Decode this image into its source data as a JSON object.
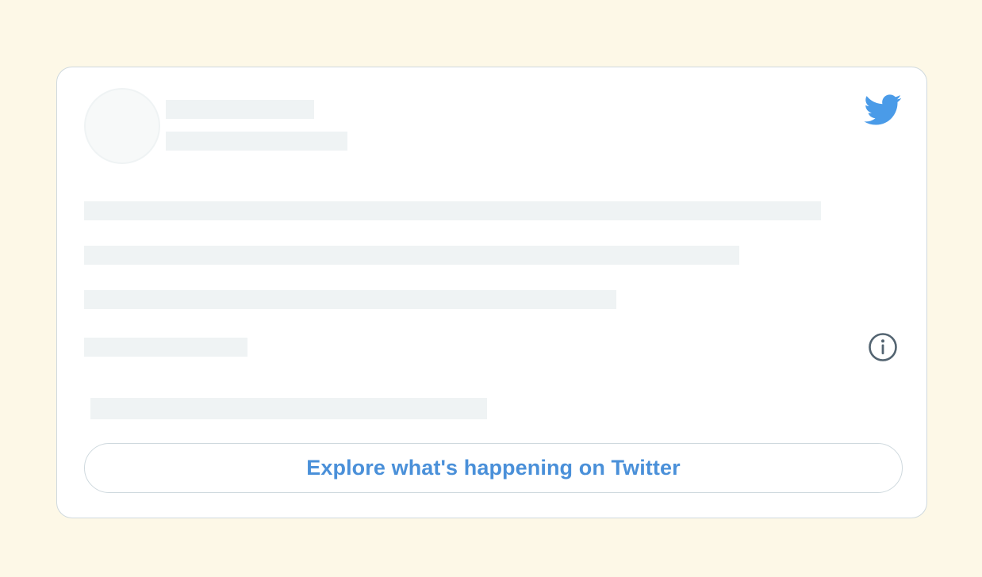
{
  "embed": {
    "explore_label": "Explore what's happening on Twitter",
    "logo_icon": "twitter-bird-icon",
    "info_icon": "info-icon",
    "colors": {
      "background": "#fdf8e7",
      "card": "#ffffff",
      "border": "#cfd9de",
      "skeleton": "#eff3f4",
      "accent": "#4a90d9",
      "bird": "#4a9be8",
      "info": "#536471"
    }
  }
}
